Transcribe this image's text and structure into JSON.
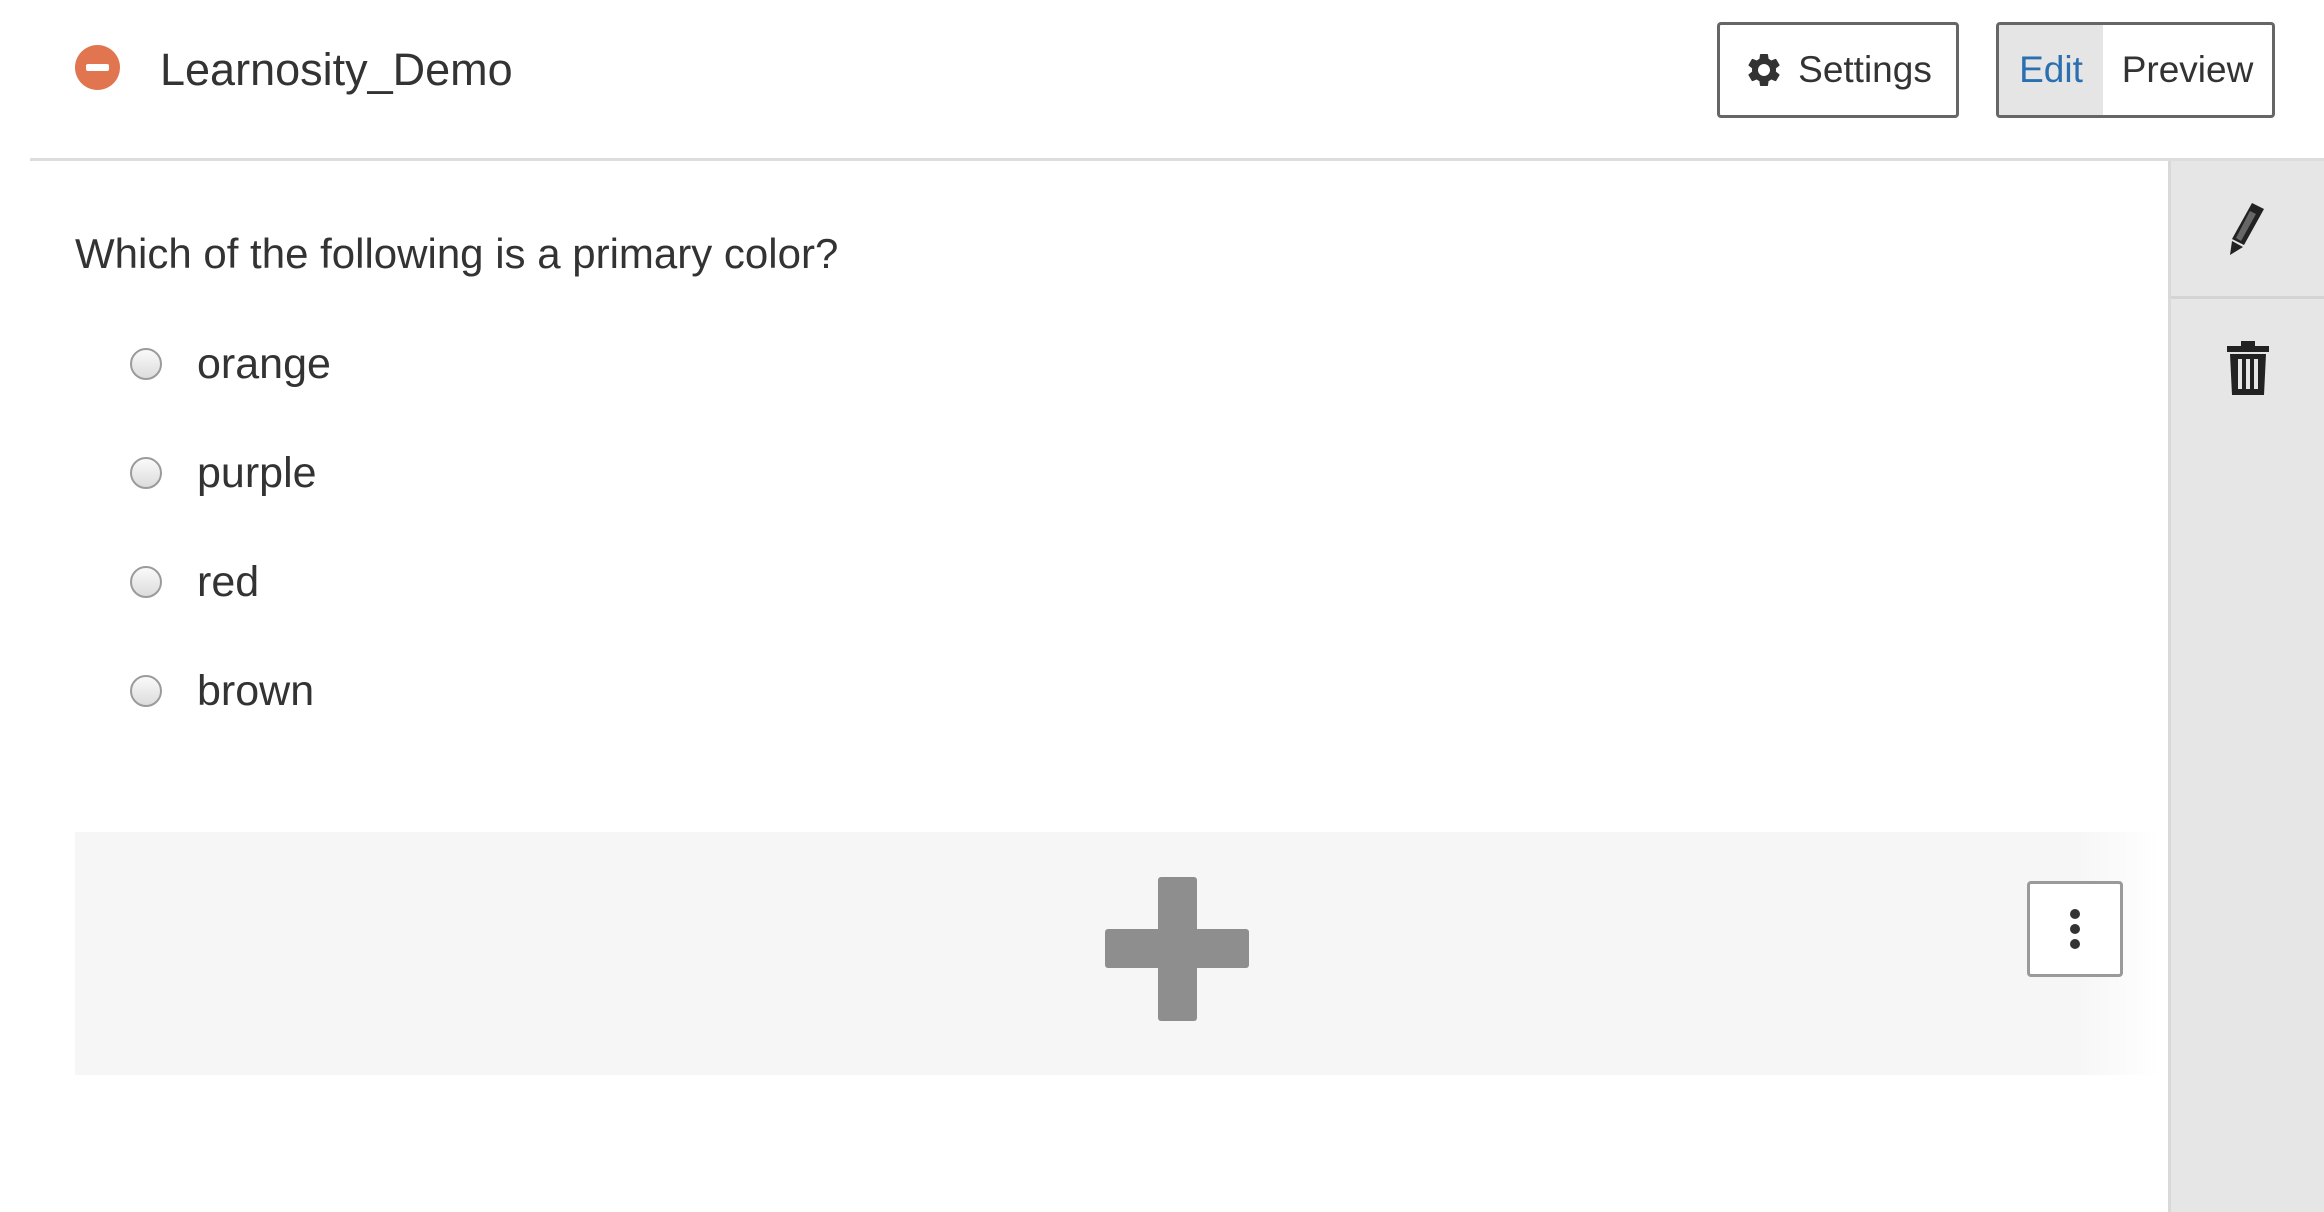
{
  "header": {
    "title": "Learnosity_Demo",
    "status_icon": "minus-circle-icon",
    "settings_label": "Settings",
    "settings_icon": "gear-icon",
    "mode_toggle": {
      "edit_label": "Edit",
      "preview_label": "Preview",
      "active": "Edit"
    }
  },
  "question": {
    "stem": "Which of the following is a primary color?",
    "options": [
      {
        "label": "orange"
      },
      {
        "label": "purple"
      },
      {
        "label": "red"
      },
      {
        "label": "brown"
      }
    ]
  },
  "side_panel": {
    "tools": [
      "pencil-icon",
      "trash-icon"
    ]
  },
  "add_zone": {
    "add_icon": "plus-icon",
    "more_icon": "vertical-ellipsis-icon"
  },
  "colors": {
    "status_accent": "#e0754f",
    "active_tab_text": "#2a6fb0",
    "active_tab_bg": "#e5e5e5",
    "side_panel_bg": "#e6e6e6",
    "add_zone_bg": "#f6f6f6",
    "plus_icon": "#8e8e8e"
  }
}
